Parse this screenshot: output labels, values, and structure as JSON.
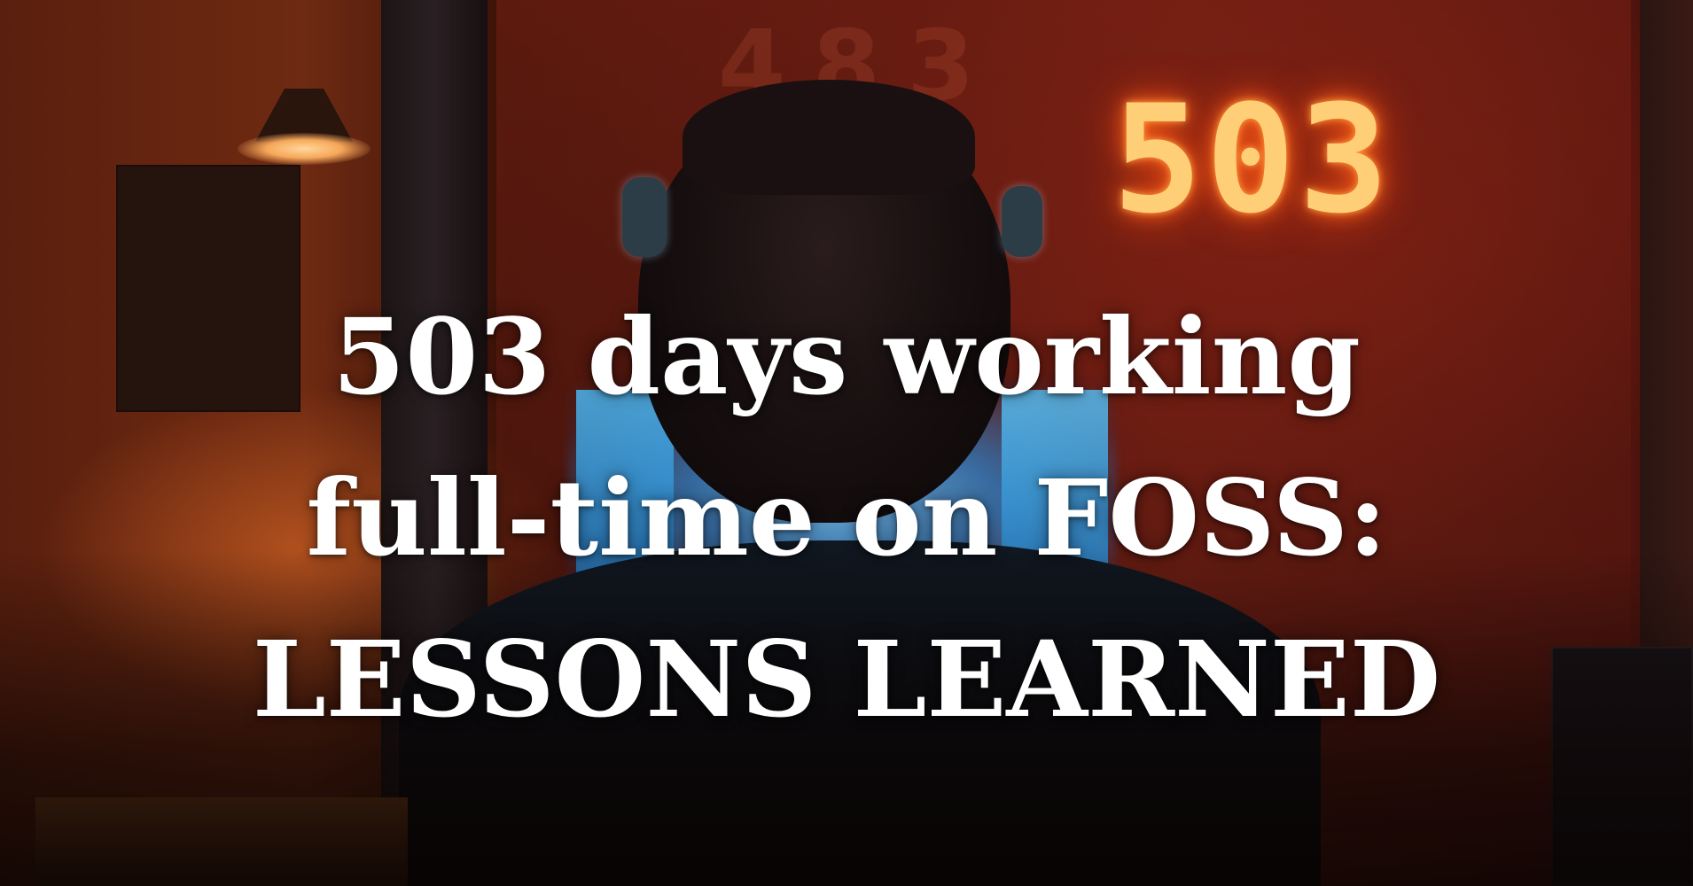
{
  "image": {
    "headline": {
      "line1": "503 days working",
      "line2": "full-time on FOSS:",
      "line3": "LESSONS LEARNED"
    },
    "neon_sign": "503",
    "background_digits": "483",
    "colors": {
      "neon": "#ffcf78",
      "background_red": "#6a1d12",
      "screen_blue": "#4bb6f0",
      "text": "#ffffff"
    }
  }
}
